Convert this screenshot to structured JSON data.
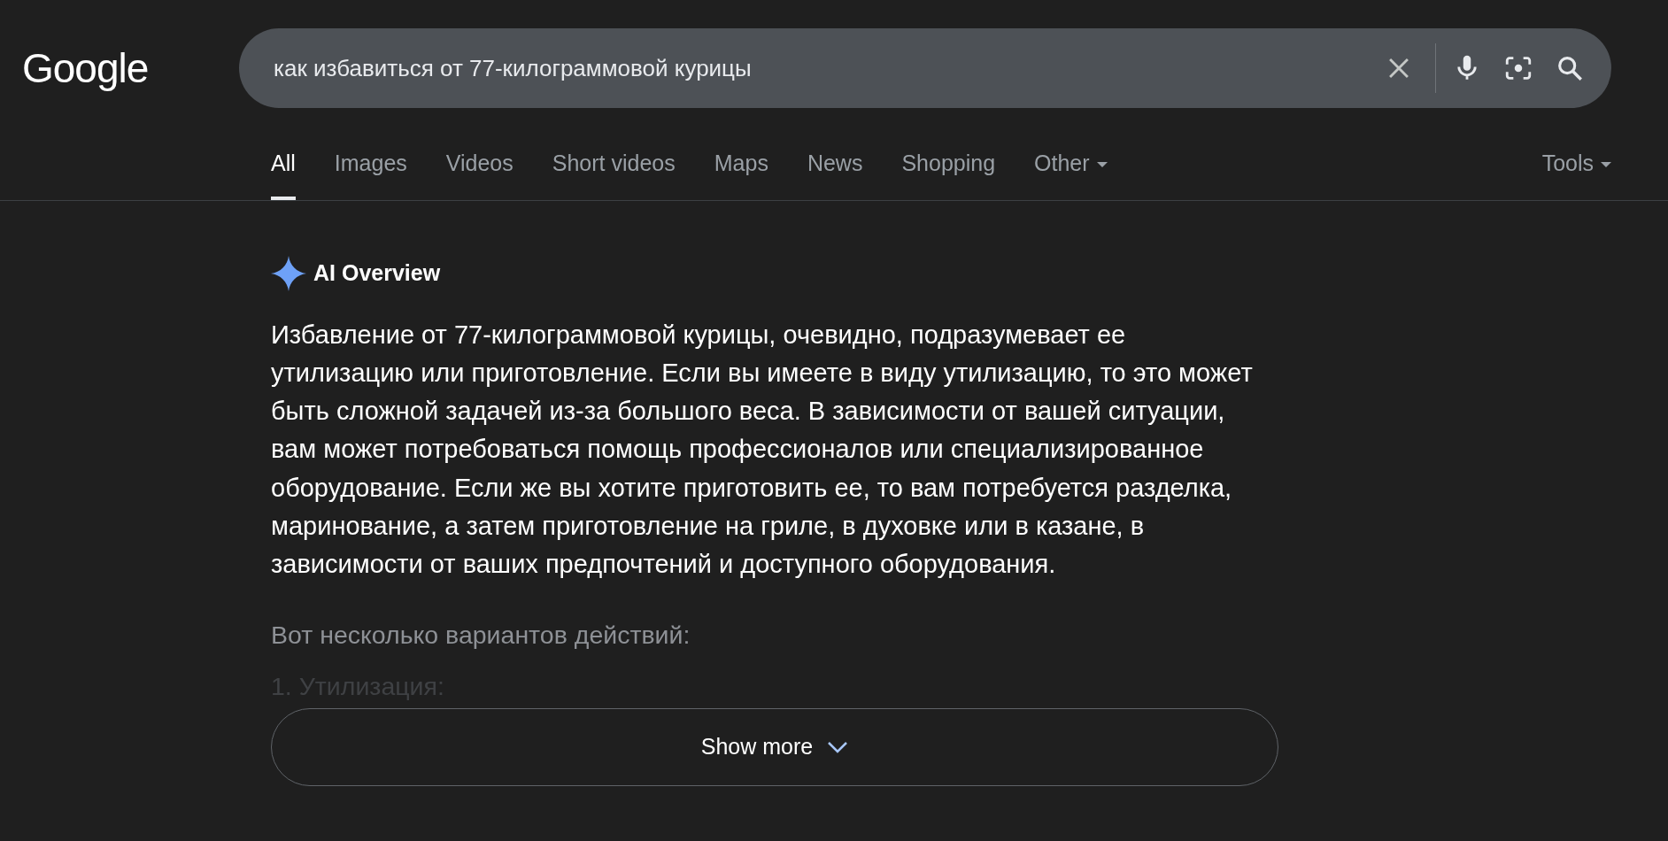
{
  "logo": "Google",
  "search": {
    "value": "как избавиться от 77-килограммовой курицы"
  },
  "tabs": [
    {
      "label": "All",
      "selected": true,
      "dropdown": false
    },
    {
      "label": "Images",
      "selected": false,
      "dropdown": false
    },
    {
      "label": "Videos",
      "selected": false,
      "dropdown": false
    },
    {
      "label": "Short videos",
      "selected": false,
      "dropdown": false
    },
    {
      "label": "Maps",
      "selected": false,
      "dropdown": false
    },
    {
      "label": "News",
      "selected": false,
      "dropdown": false
    },
    {
      "label": "Shopping",
      "selected": false,
      "dropdown": false
    },
    {
      "label": "Other",
      "selected": false,
      "dropdown": true
    }
  ],
  "tools": {
    "label": "Tools"
  },
  "ai_overview": {
    "title": "AI Overview",
    "paragraph": "Избавление от 77-килограммовой курицы, очевидно, подразумевает ее утилизацию или приготовление. Если вы имеете в виду утилизацию, то это может быть сложной задачей из-за большого веса. В зависимости от вашей ситуации, вам может потребоваться помощь профессионалов или специализированное оборудование. Если же вы хотите приготовить ее, то вам потребуется разделка, маринование, а затем приготовление на гриле, в духовке или в казане, в зависимости от ваших предпочтений и доступного оборудования.",
    "faded_lines": [
      "Вот несколько вариантов действий:",
      "1. Утилизация:"
    ],
    "show_more": "Show more"
  }
}
